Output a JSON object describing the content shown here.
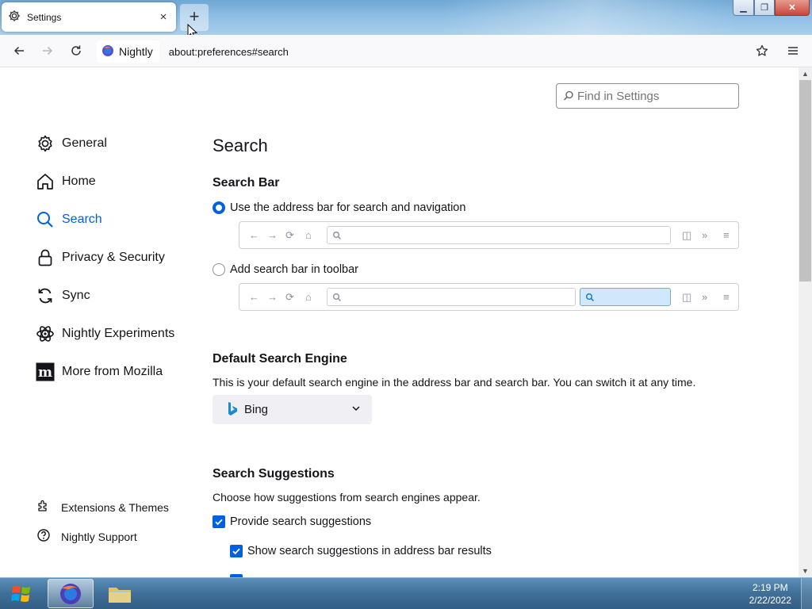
{
  "browser": {
    "tab_title": "Settings",
    "tab_close": "×",
    "new_tab": "+",
    "identity_label": "Nightly",
    "url": "about:preferences#search"
  },
  "settings": {
    "find_placeholder": "Find in Settings",
    "categories": [
      {
        "label": "General",
        "icon": "gear-icon"
      },
      {
        "label": "Home",
        "icon": "home-icon"
      },
      {
        "label": "Search",
        "icon": "search-icon",
        "active": true
      },
      {
        "label": "Privacy & Security",
        "icon": "lock-icon"
      },
      {
        "label": "Sync",
        "icon": "sync-icon"
      },
      {
        "label": "Nightly Experiments",
        "icon": "experiments-icon"
      },
      {
        "label": "More from Mozilla",
        "icon": "mozilla-icon"
      }
    ],
    "footer": [
      {
        "label": "Extensions & Themes",
        "icon": "puzzle-icon"
      },
      {
        "label": "Nightly Support",
        "icon": "help-icon"
      }
    ],
    "page_title": "Search",
    "search_bar": {
      "heading": "Search Bar",
      "option_address": "Use the address bar for search and navigation",
      "option_toolbar": "Add search bar in toolbar"
    },
    "default_engine": {
      "heading": "Default Search Engine",
      "description": "This is your default search engine in the address bar and search bar. You can switch it at any time.",
      "selected": "Bing"
    },
    "suggestions": {
      "heading": "Search Suggestions",
      "description": "Choose how suggestions from search engines appear.",
      "provide": "Provide search suggestions",
      "show_in_address": "Show search suggestions in address bar results"
    }
  },
  "taskbar": {
    "time": "2:19 PM",
    "date": "2/22/2022"
  },
  "colors": {
    "accent": "#0061e0"
  }
}
